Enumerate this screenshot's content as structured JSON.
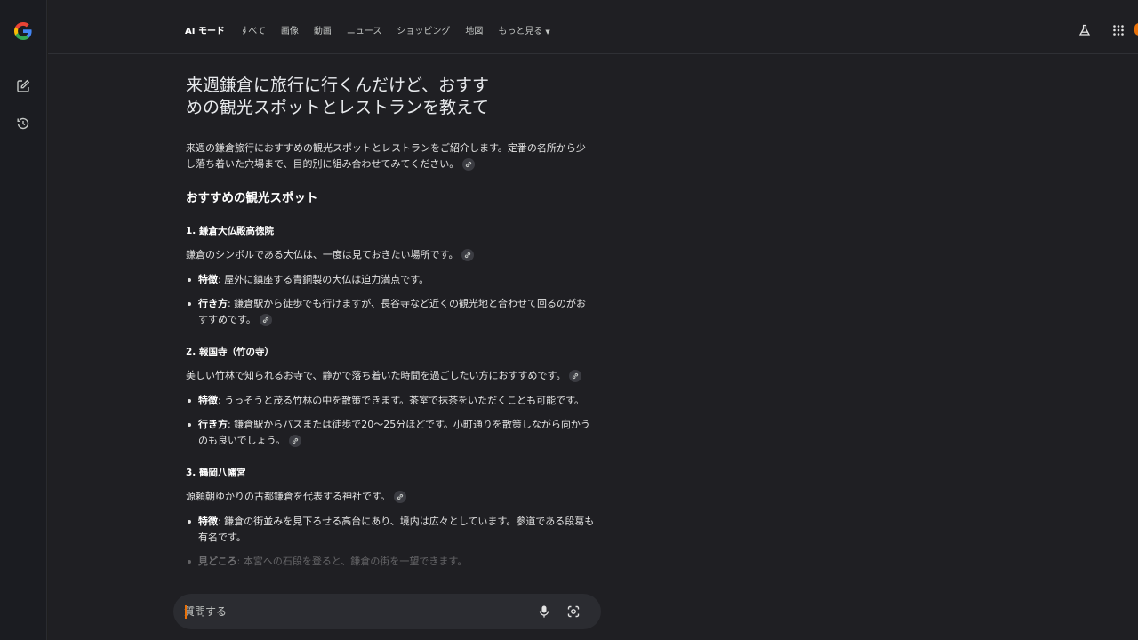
{
  "nav": {
    "tabs": [
      {
        "label": "AI モード"
      },
      {
        "label": "すべて"
      },
      {
        "label": "画像"
      },
      {
        "label": "動画"
      },
      {
        "label": "ニュース"
      },
      {
        "label": "ショッピング"
      },
      {
        "label": "地図"
      },
      {
        "label": "もっと見る"
      }
    ]
  },
  "query": {
    "line1": "来週鎌倉に旅行に行くんだけど、おすす",
    "line2": "めの観光スポットとレストランを教えて"
  },
  "answer": {
    "intro": "来週の鎌倉旅行におすすめの観光スポットとレストランをご紹介します。定番の名所から少し落ち着いた穴場まで、目的別に組み合わせてみてください。",
    "section_title": "おすすめの観光スポット",
    "spots": [
      {
        "title": "1. 鎌倉大仏殿高徳院",
        "desc": "鎌倉のシンボルである大仏は、一度は見ておきたい場所です。",
        "features": [
          {
            "label": "特徴",
            "text": ": 屋外に鎮座する青銅製の大仏は迫力満点です。"
          },
          {
            "label": "行き方",
            "text": ": 鎌倉駅から徒歩でも行けますが、長谷寺など近くの観光地と合わせて回るのがおすすめです。"
          }
        ]
      },
      {
        "title": "2. 報国寺（竹の寺）",
        "desc": "美しい竹林で知られるお寺で、静かで落ち着いた時間を過ごしたい方におすすめです。",
        "features": [
          {
            "label": "特徴",
            "text": ": うっそうと茂る竹林の中を散策できます。茶室で抹茶をいただくことも可能です。"
          },
          {
            "label": "行き方",
            "text": ": 鎌倉駅からバスまたは徒歩で20〜25分ほどです。小町通りを散策しながら向かうのも良いでしょう。"
          }
        ]
      },
      {
        "title": "3. 鶴岡八幡宮",
        "desc": "源頼朝ゆかりの古都鎌倉を代表する神社です。",
        "features": [
          {
            "label": "特徴",
            "text": ": 鎌倉の街並みを見下ろせる高台にあり、境内は広々としています。参道である段葛も有名です。"
          },
          {
            "label": "見どころ",
            "text": ": 本宮への石段を登ると、鎌倉の街を一望できます。"
          }
        ]
      }
    ]
  },
  "input": {
    "placeholder": "質問する"
  },
  "colors": {
    "background": "#1f1f23",
    "rail": "#1b1c21",
    "input_bg": "#2b2c31",
    "accent": "#e8710a"
  },
  "icons": [
    "google-logo",
    "new-chat-icon",
    "history-icon",
    "labs-flask-icon",
    "apps-grid-icon",
    "link-icon",
    "mic-icon",
    "lens-camera-icon"
  ]
}
